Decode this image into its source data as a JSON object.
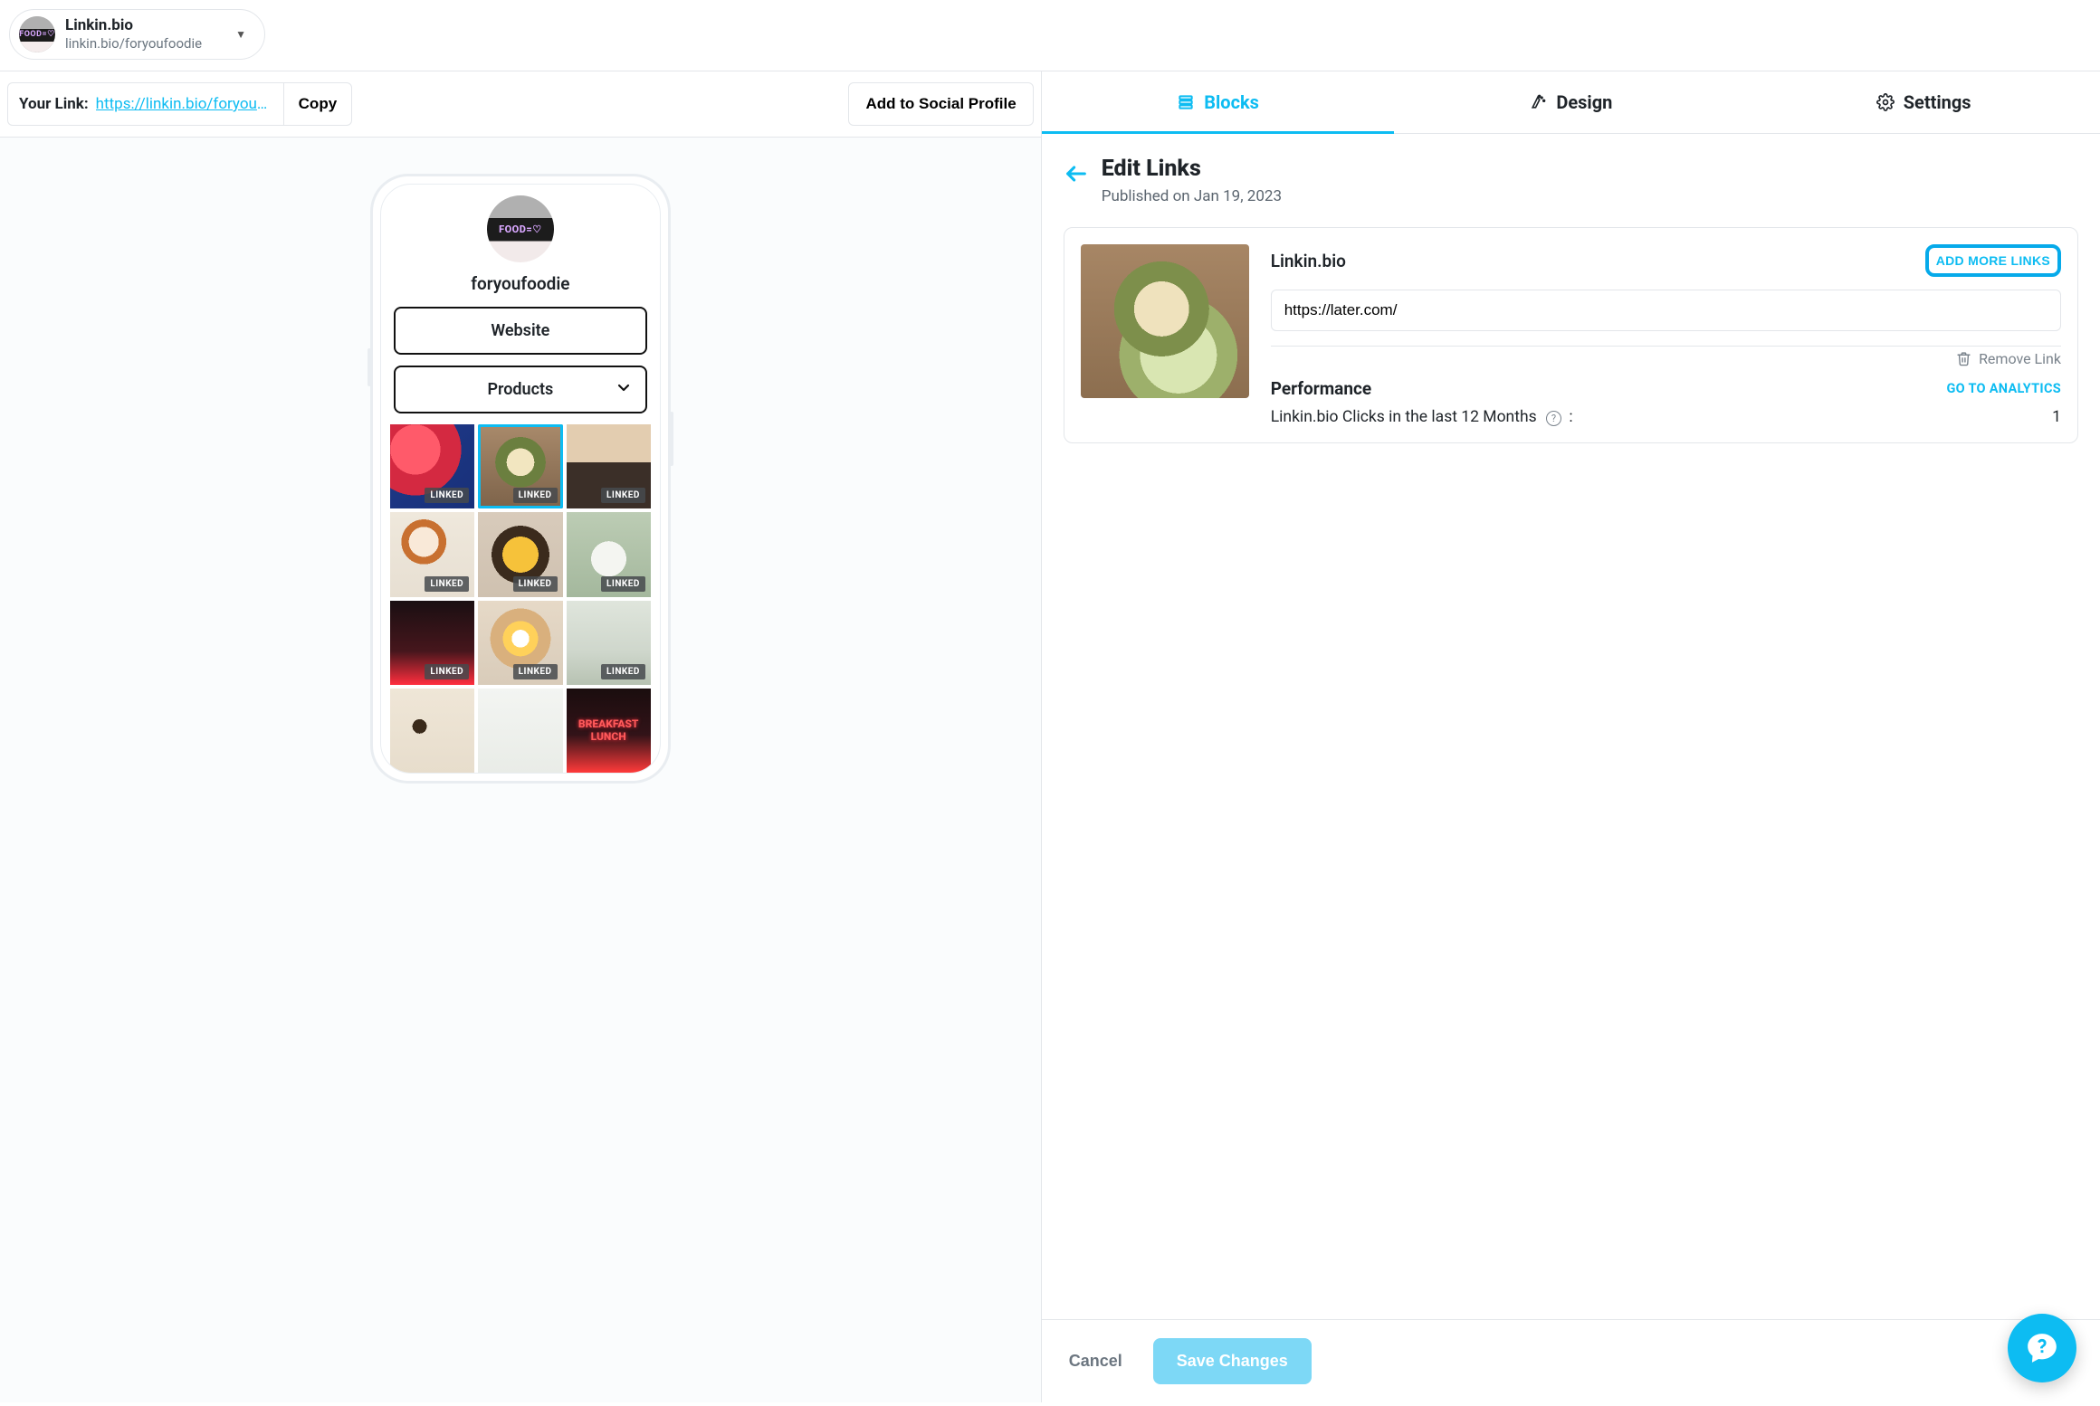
{
  "account": {
    "title": "Linkin.bio",
    "subtitle": "linkin.bio/foryoufoodie",
    "avatar_text": "FOOD=♡"
  },
  "left_toolbar": {
    "your_link_label": "Your Link:",
    "your_link_url": "https://linkin.bio/foryoufoo...",
    "copy_label": "Copy",
    "add_social_label": "Add to Social Profile"
  },
  "preview": {
    "avatar_text": "FOOD=♡",
    "username": "foryoufoodie",
    "buttons": {
      "website": "Website",
      "products": "Products"
    },
    "linked_tag": "LINKED",
    "grid": [
      {
        "linked": true
      },
      {
        "linked": true,
        "selected": true
      },
      {
        "linked": true
      },
      {
        "linked": true
      },
      {
        "linked": true
      },
      {
        "linked": true
      },
      {
        "linked": true
      },
      {
        "linked": true
      },
      {
        "linked": true
      },
      {
        "linked": false
      },
      {
        "linked": false
      },
      {
        "linked": false,
        "neon_l1": "BREAKFAST",
        "neon_l2": "LUNCH"
      }
    ]
  },
  "tabs": {
    "blocks": "Blocks",
    "design": "Design",
    "settings": "Settings"
  },
  "edit_links": {
    "back_icon": "arrow-left",
    "title": "Edit Links",
    "subtitle": "Published on Jan 19, 2023",
    "card": {
      "source_label": "Linkin.bio",
      "add_more_label": "ADD MORE LINKS",
      "url_value": "https://later.com/",
      "remove_label": "Remove Link",
      "performance_label": "Performance",
      "analytics_label": "GO TO ANALYTICS",
      "clicks_label": "Linkin.bio Clicks in the last 12 Months",
      "clicks_suffix": " :",
      "clicks_value": "1"
    }
  },
  "footer": {
    "cancel": "Cancel",
    "save": "Save Changes"
  }
}
